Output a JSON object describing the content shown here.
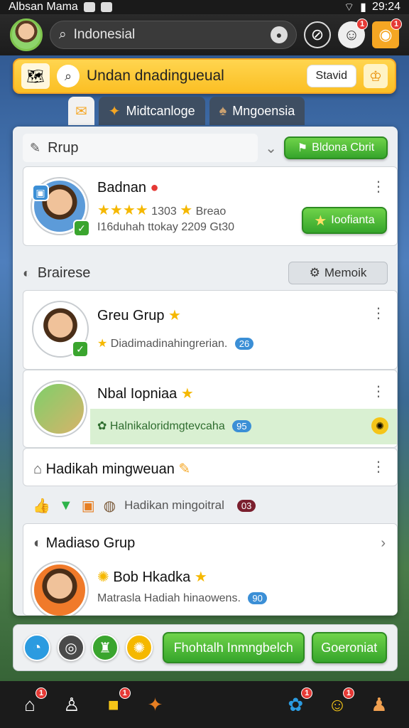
{
  "status_bar": {
    "carrier": "Albsan Mama",
    "time": "29:24"
  },
  "top_nav": {
    "search_text": "Indonesial",
    "icons": [
      "compass-icon",
      "people-icon",
      "notification-icon"
    ],
    "badges": [
      "1",
      "1"
    ]
  },
  "banner": {
    "text": "Undan dnadingueual",
    "pill": "Stavid"
  },
  "tabs": [
    {
      "label": ""
    },
    {
      "label": "Midtcanloge"
    },
    {
      "label": "Mngoensia"
    }
  ],
  "group_section": {
    "title": "Rrup",
    "button": "Bldona Cbrit"
  },
  "top_card": {
    "name": "Badnan",
    "rating_text": "1303",
    "rating_suffix": "Breao",
    "sub": "I16duhah ttokay 2209 Gt30",
    "button": "Ioofianta"
  },
  "browse_section": {
    "title": "Brairese",
    "button": "Memoik"
  },
  "list": [
    {
      "name": "Greu Grup",
      "sub": "Diadimadinahingrerian.",
      "count": "26"
    },
    {
      "name": "Nbal Iopniaa",
      "sub": "Halnikaloridmgtevcaha",
      "count": "95"
    },
    {
      "name": "Hadikah mingweuan",
      "sub": ""
    }
  ],
  "reaction_row": {
    "text": "Hadikan mingoitral",
    "count": "03"
  },
  "group_card": {
    "title": "Madiaso Grup",
    "name": "Bob Hkadka",
    "sub": "Matrasla Hadiah hinaowens.",
    "count": "90"
  },
  "action_bar": {
    "primary": "Fhohtalh Inmngbelch",
    "secondary": "Goeroniat"
  },
  "bottom_nav": {
    "items": [
      "home-icon",
      "profile-icon",
      "store-icon",
      "gift-icon",
      "games-icon",
      "pets-icon",
      "user-icon"
    ],
    "badges": [
      "1",
      "1",
      "1",
      "1"
    ]
  }
}
